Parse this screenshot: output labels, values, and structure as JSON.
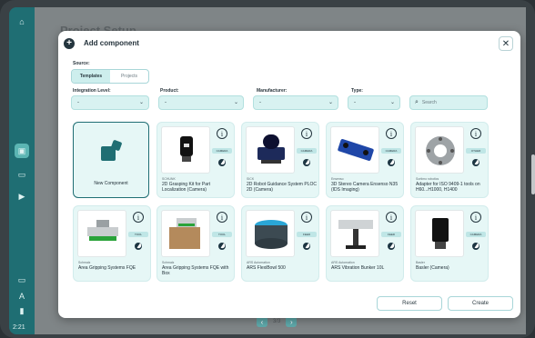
{
  "background": {
    "title": "Project Setup",
    "pager_text": "3/3",
    "time": "2:21"
  },
  "dialog": {
    "title": "Add component",
    "close_icon": "close-icon"
  },
  "source": {
    "label": "Source:",
    "tabs": [
      "Templates",
      "Projects"
    ],
    "selected": "Templates"
  },
  "filters": {
    "integration_level": {
      "label": "Integration Level:",
      "value": "-"
    },
    "product": {
      "label": "Product:",
      "value": "-"
    },
    "manufacturer": {
      "label": "Manufacturer:",
      "value": "-"
    },
    "type": {
      "label": "Type:",
      "value": "-"
    },
    "search_placeholder": "Search"
  },
  "new_component": {
    "label": "New Component"
  },
  "cards": [
    {
      "vendor": "SCHUNK",
      "name": "2D Grasping Kit for Part Localization (Camera)",
      "tag": "CAMERA"
    },
    {
      "vendor": "SICK",
      "name": "2D Robot Guidance System PLOC 2D (Camera)",
      "tag": "CAMERA"
    },
    {
      "vendor": "Ensenso",
      "name": "3D Stereo Camera Ensenso N35 (IDS Imaging)",
      "tag": "CAMERA"
    },
    {
      "vendor": "Sortimo robotics",
      "name": "Adapter for ISO 9409-1 tools on H60...H1000, H1400",
      "tag": "OTHER"
    },
    {
      "vendor": "Schmalz",
      "name": "Area Gripping Systems FQE",
      "tag": "TOOL"
    },
    {
      "vendor": "Schmalz",
      "name": "Area Gripping Systems FQE with Box",
      "tag": "TOOL"
    },
    {
      "vendor": "ARS Automation",
      "name": "ARS FlexiBowl 500",
      "tag": "FEED"
    },
    {
      "vendor": "ARS Automation",
      "name": "ARS Vibration Bunker 10L",
      "tag": "FEED"
    },
    {
      "vendor": "Basler",
      "name": "Basler (Camera)",
      "tag": "CAMERA"
    }
  ],
  "actions": {
    "reset": "Reset",
    "create": "Create"
  },
  "colors": {
    "accent": "#1f6e73",
    "field_bg": "#d8f2f1",
    "card_bg": "#e6f7f6"
  }
}
